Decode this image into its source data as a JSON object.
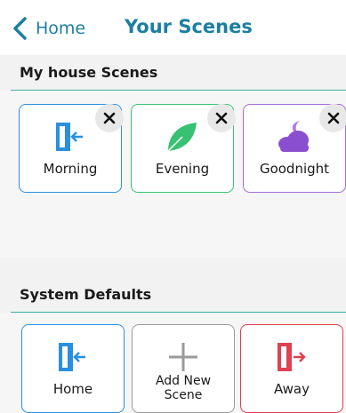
{
  "nav": {
    "back_label": "Home",
    "title": "Your Scenes"
  },
  "sections": {
    "my_scenes": "My house Scenes",
    "system_defaults": "System Defaults"
  },
  "my_scenes": [
    {
      "label": "Morning",
      "icon": "door-enter-icon",
      "color": "#2b8fe0"
    },
    {
      "label": "Evening",
      "icon": "leaf-icon",
      "color": "#38c172"
    },
    {
      "label": "Goodnight",
      "icon": "moon-cloud-icon",
      "color": "#a56ad8"
    }
  ],
  "system_defaults": [
    {
      "label": "Home",
      "icon": "door-enter-icon",
      "color": "#2b8fe0"
    },
    {
      "label_line1": "Add New",
      "label_line2": "Scene",
      "icon": "plus-icon",
      "color": "#9a9a9a"
    },
    {
      "label": "Away",
      "icon": "door-exit-icon",
      "color": "#e04050"
    }
  ],
  "colors": {
    "accent": "#1c7fa0",
    "rule": "#3fb3a4"
  },
  "close_glyph": "×"
}
